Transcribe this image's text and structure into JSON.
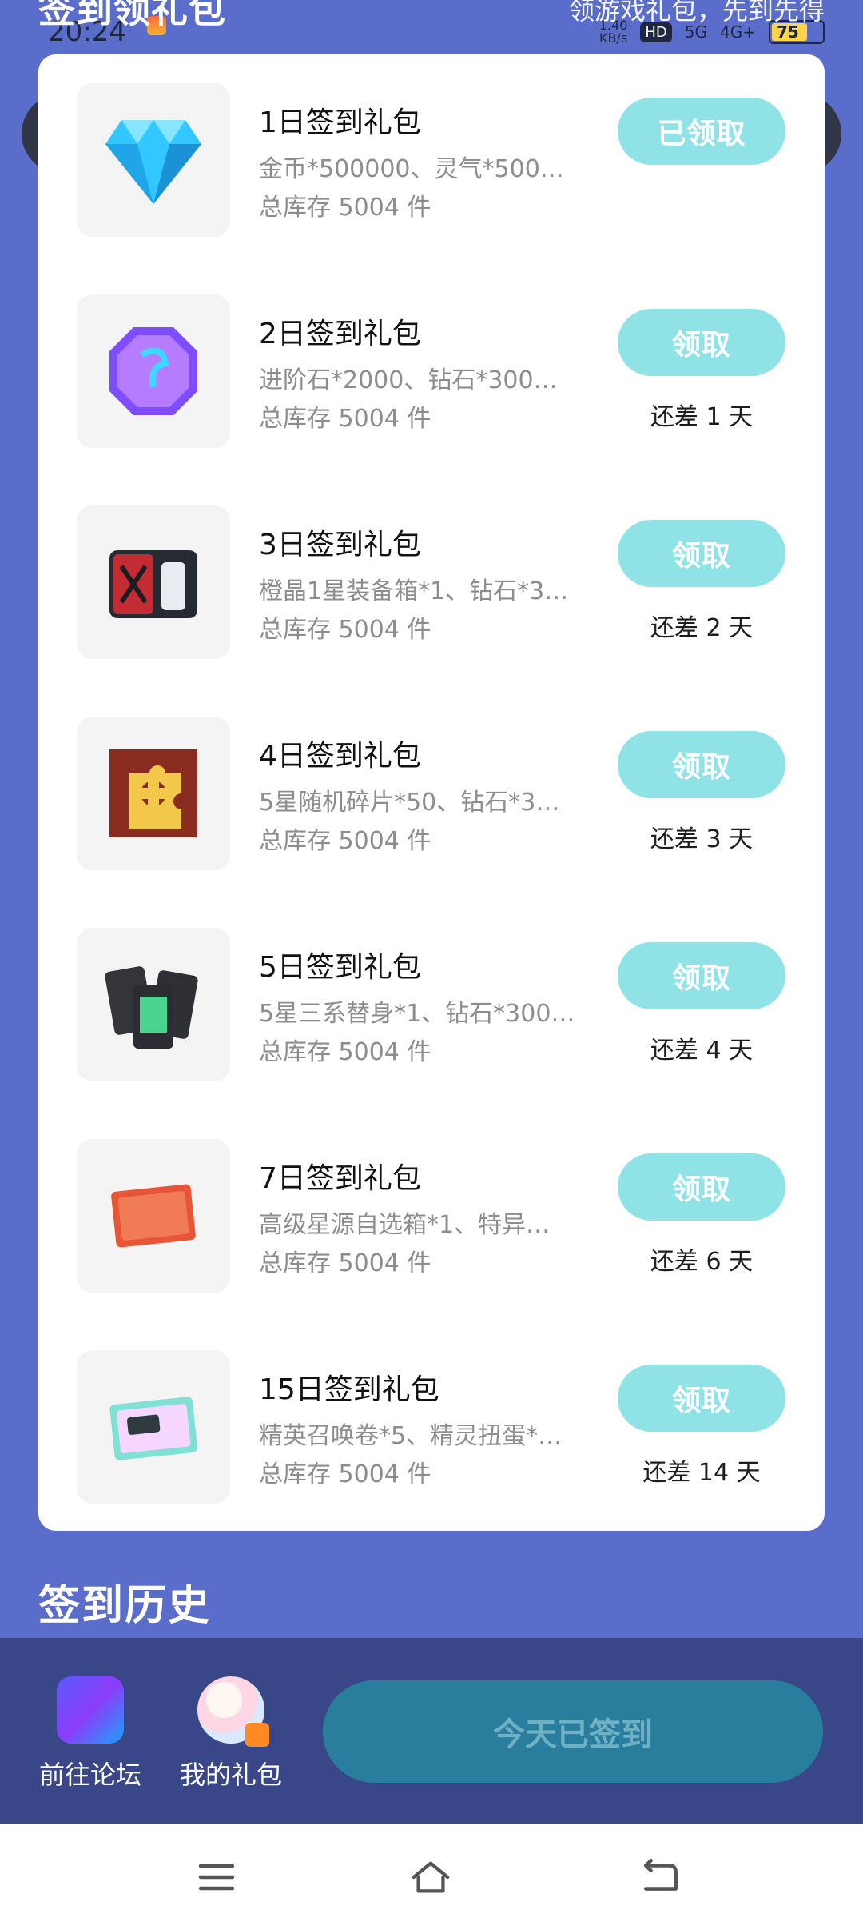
{
  "status_bar": {
    "time": "20:24",
    "network_speed": "1.40\nKB/s",
    "hd_label": "HD",
    "signal_label": "5G",
    "signal2_label": "4G+",
    "battery": "75"
  },
  "header": {
    "title": "签到领礼包",
    "subtitle": "领游戏礼包，先到先得"
  },
  "gifts": [
    {
      "title": "1日签到礼包",
      "desc": "金币*500000、灵气*500…",
      "stock": "总库存 5004 件",
      "action": "已领取",
      "remain": ""
    },
    {
      "title": "2日签到礼包",
      "desc": "进阶石*2000、钻石*300…",
      "stock": "总库存 5004 件",
      "action": "领取",
      "remain": "还差 1 天"
    },
    {
      "title": "3日签到礼包",
      "desc": "橙晶1星装备箱*1、钻石*3…",
      "stock": "总库存 5004 件",
      "action": "领取",
      "remain": "还差 2 天"
    },
    {
      "title": "4日签到礼包",
      "desc": "5星随机碎片*50、钻石*3…",
      "stock": "总库存 5004 件",
      "action": "领取",
      "remain": "还差 3 天"
    },
    {
      "title": "5日签到礼包",
      "desc": "5星三系替身*1、钻石*300…",
      "stock": "总库存 5004 件",
      "action": "领取",
      "remain": "还差 4 天"
    },
    {
      "title": "7日签到礼包",
      "desc": "高级星源自选箱*1、特异…",
      "stock": "总库存 5004 件",
      "action": "领取",
      "remain": "还差 6 天"
    },
    {
      "title": "15日签到礼包",
      "desc": "精英召唤卷*5、精灵扭蛋*…",
      "stock": "总库存 5004 件",
      "action": "领取",
      "remain": "还差 14 天"
    }
  ],
  "history": {
    "title": "签到历史"
  },
  "bottom": {
    "forum_label": "前往论坛",
    "gift_label": "我的礼包",
    "checkin_label": "今天已签到"
  }
}
